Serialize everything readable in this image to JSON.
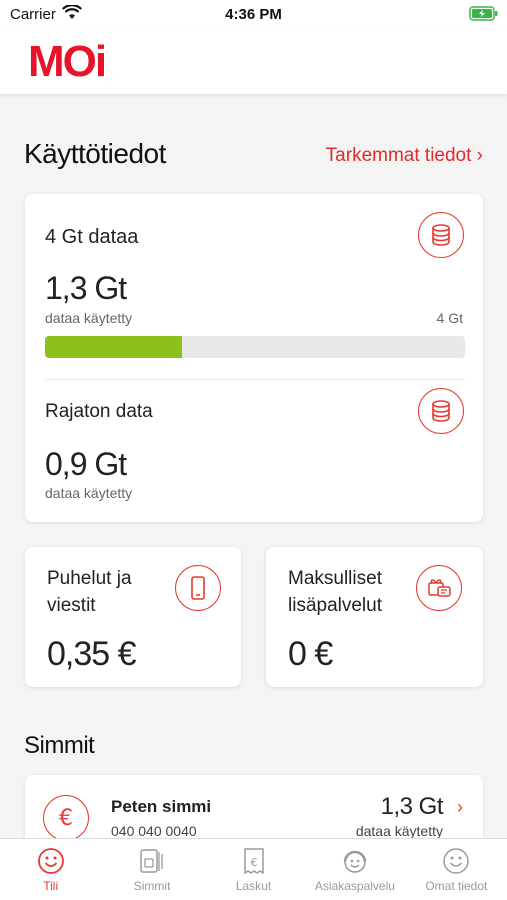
{
  "status_bar": {
    "carrier": "Carrier",
    "time": "4:36 PM"
  },
  "header": {
    "logo_text": "MOi"
  },
  "usage": {
    "title": "Käyttötiedot",
    "more_link": "Tarkemmat tiedot ›",
    "plan": {
      "name": "4 Gt dataa",
      "used": "1,3 Gt",
      "used_label": "dataa käytetty",
      "limit": "4 Gt",
      "progress_fraction": 0.325
    },
    "unlimited": {
      "name": "Rajaton data",
      "used": "0,9 Gt",
      "used_label": "dataa käytetty"
    }
  },
  "calls": {
    "title_line1": "Puhelut ja",
    "title_line2": "viestit",
    "amount": "0,35 €"
  },
  "extras": {
    "title_line1": "Maksulliset",
    "title_line2": "lisäpalvelut",
    "amount": "0 €"
  },
  "sims": {
    "title": "Simmit",
    "item": {
      "name": "Peten simmi",
      "number": "040 040 0040",
      "used": "1,3 Gt",
      "used_label": "dataa käytetty"
    }
  },
  "tabs": [
    {
      "label": "Tili",
      "icon": "smiley-icon",
      "active": true
    },
    {
      "label": "Simmit",
      "icon": "sim-icon",
      "active": false
    },
    {
      "label": "Laskut",
      "icon": "receipt-icon",
      "active": false
    },
    {
      "label": "Asiakaspalvelu",
      "icon": "support-icon",
      "active": false
    },
    {
      "label": "Omat tiedot",
      "icon": "profile-icon",
      "active": false
    }
  ],
  "colors": {
    "accent": "#e63b2e",
    "progress": "#8dc01a",
    "background": "#f4f4f4"
  }
}
